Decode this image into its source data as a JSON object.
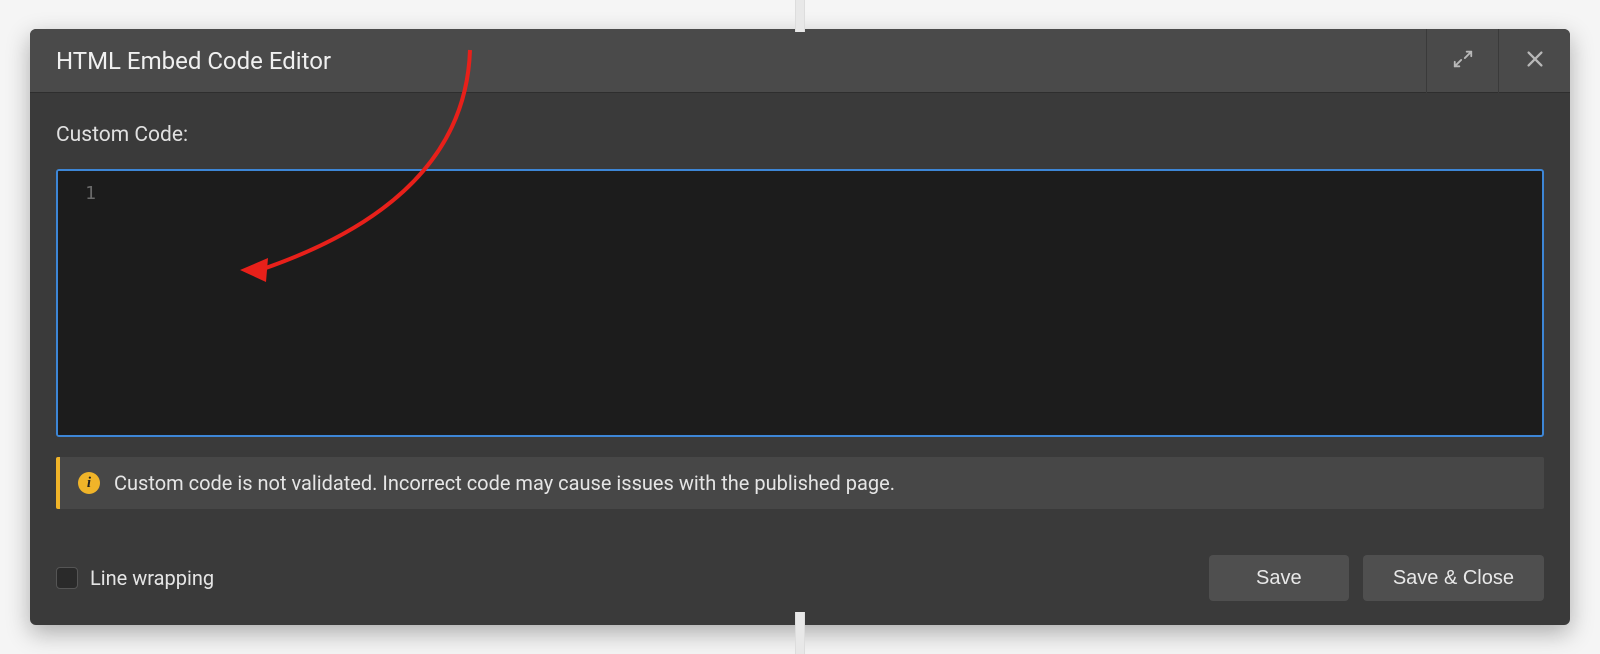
{
  "modal": {
    "title": "HTML Embed Code Editor",
    "field_label": "Custom Code:",
    "line_number": "1",
    "info_message": "Custom code is not validated. Incorrect code may cause issues with the published page.",
    "line_wrapping_label": "Line wrapping",
    "save_label": "Save",
    "save_close_label": "Save & Close"
  }
}
